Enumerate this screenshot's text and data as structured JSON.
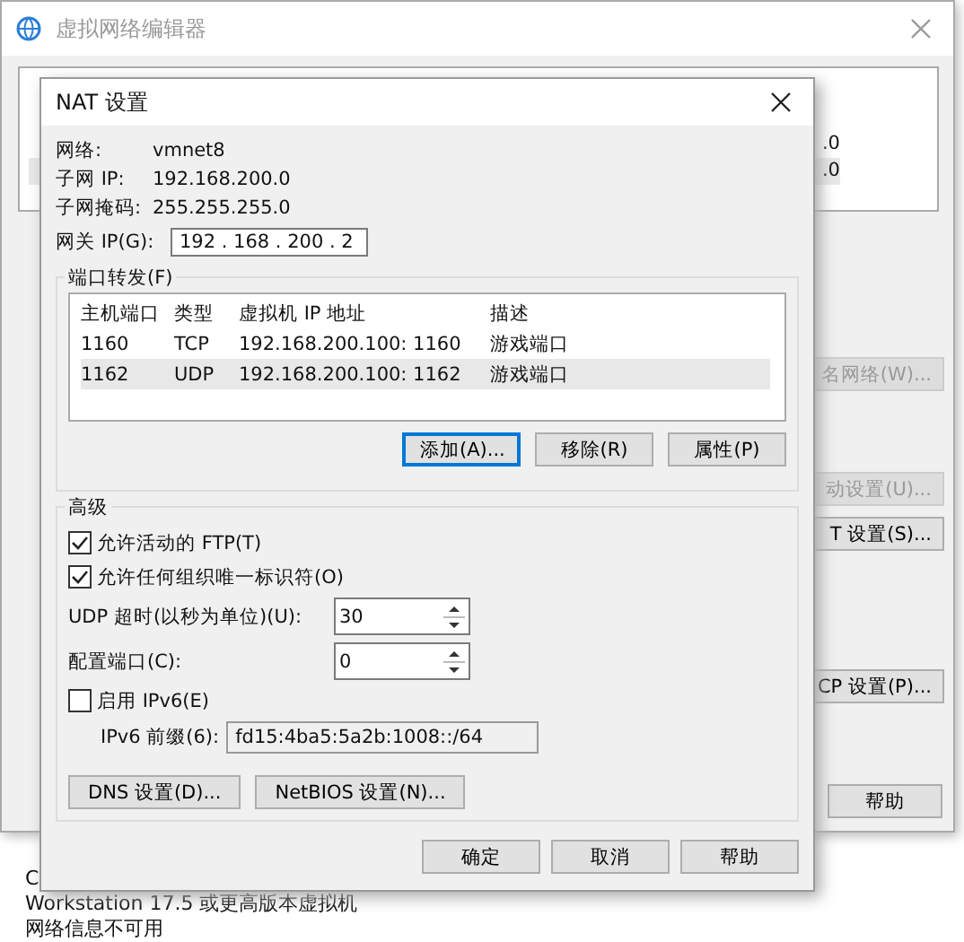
{
  "background_window": {
    "title": "虚拟网络编辑器",
    "list": {
      "rows": [
        {
          "col_2": ".0",
          "selected": false
        },
        {
          "col_2": ".0",
          "selected": true
        }
      ]
    },
    "side_buttons": [
      {
        "label": "名网络(W)...",
        "disabled": true
      },
      {
        "label": "动设置(U)...",
        "disabled": true
      },
      {
        "label": "T 设置(S)...",
        "disabled": false
      },
      {
        "label": "CP 设置(P)...",
        "disabled": false
      }
    ],
    "help_button": "帮助",
    "status_values": [
      "C",
      "Workstation 17.5 或更高版本虚拟机",
      "网络信息不可用"
    ]
  },
  "dialog": {
    "title": "NAT 设置",
    "info": [
      {
        "label": "网络:",
        "value": "vmnet8"
      },
      {
        "label": "子网 IP:",
        "value": "192.168.200.0"
      },
      {
        "label": "子网掩码:",
        "value": "255.255.255.0"
      }
    ],
    "gateway": {
      "label": "网关 IP(G):",
      "value": "192 . 168 . 200 .  2"
    },
    "port_forwarding": {
      "title": "端口转发(F)",
      "columns": [
        "主机端口",
        "类型",
        "虚拟机 IP 地址",
        "描述"
      ],
      "rows": [
        {
          "cells": [
            "1160",
            "TCP",
            "192.168.200.100: 1160",
            "游戏端口"
          ],
          "selected": false
        },
        {
          "cells": [
            "1162",
            "UDP",
            "192.168.200.100: 1162",
            "游戏端口"
          ],
          "selected": true
        }
      ],
      "buttons": [
        {
          "label": "添加(A)...",
          "focused": true
        },
        {
          "label": "移除(R)",
          "focused": false
        },
        {
          "label": "属性(P)",
          "focused": false
        }
      ]
    },
    "advanced": {
      "title": "高级",
      "checkboxes": [
        {
          "label": "允许活动的 FTP(T)",
          "checked": true
        },
        {
          "label": "允许任何组织唯一标识符(O)",
          "checked": true
        }
      ],
      "spinners": [
        {
          "label": "UDP 超时(以秒为单位)(U):",
          "value": "30"
        },
        {
          "label": "配置端口(C):",
          "value": "0"
        }
      ],
      "ipv6": {
        "label": "启用 IPv6(E)",
        "checked": false
      },
      "ipv6_prefix": {
        "label": "IPv6 前缀(6):",
        "value": "fd15:4ba5:5a2b:1008::/64"
      },
      "buttons": [
        "DNS 设置(D)...",
        "NetBIOS 设置(N)..."
      ]
    },
    "footer_buttons": [
      "确定",
      "取消",
      "帮助"
    ]
  }
}
